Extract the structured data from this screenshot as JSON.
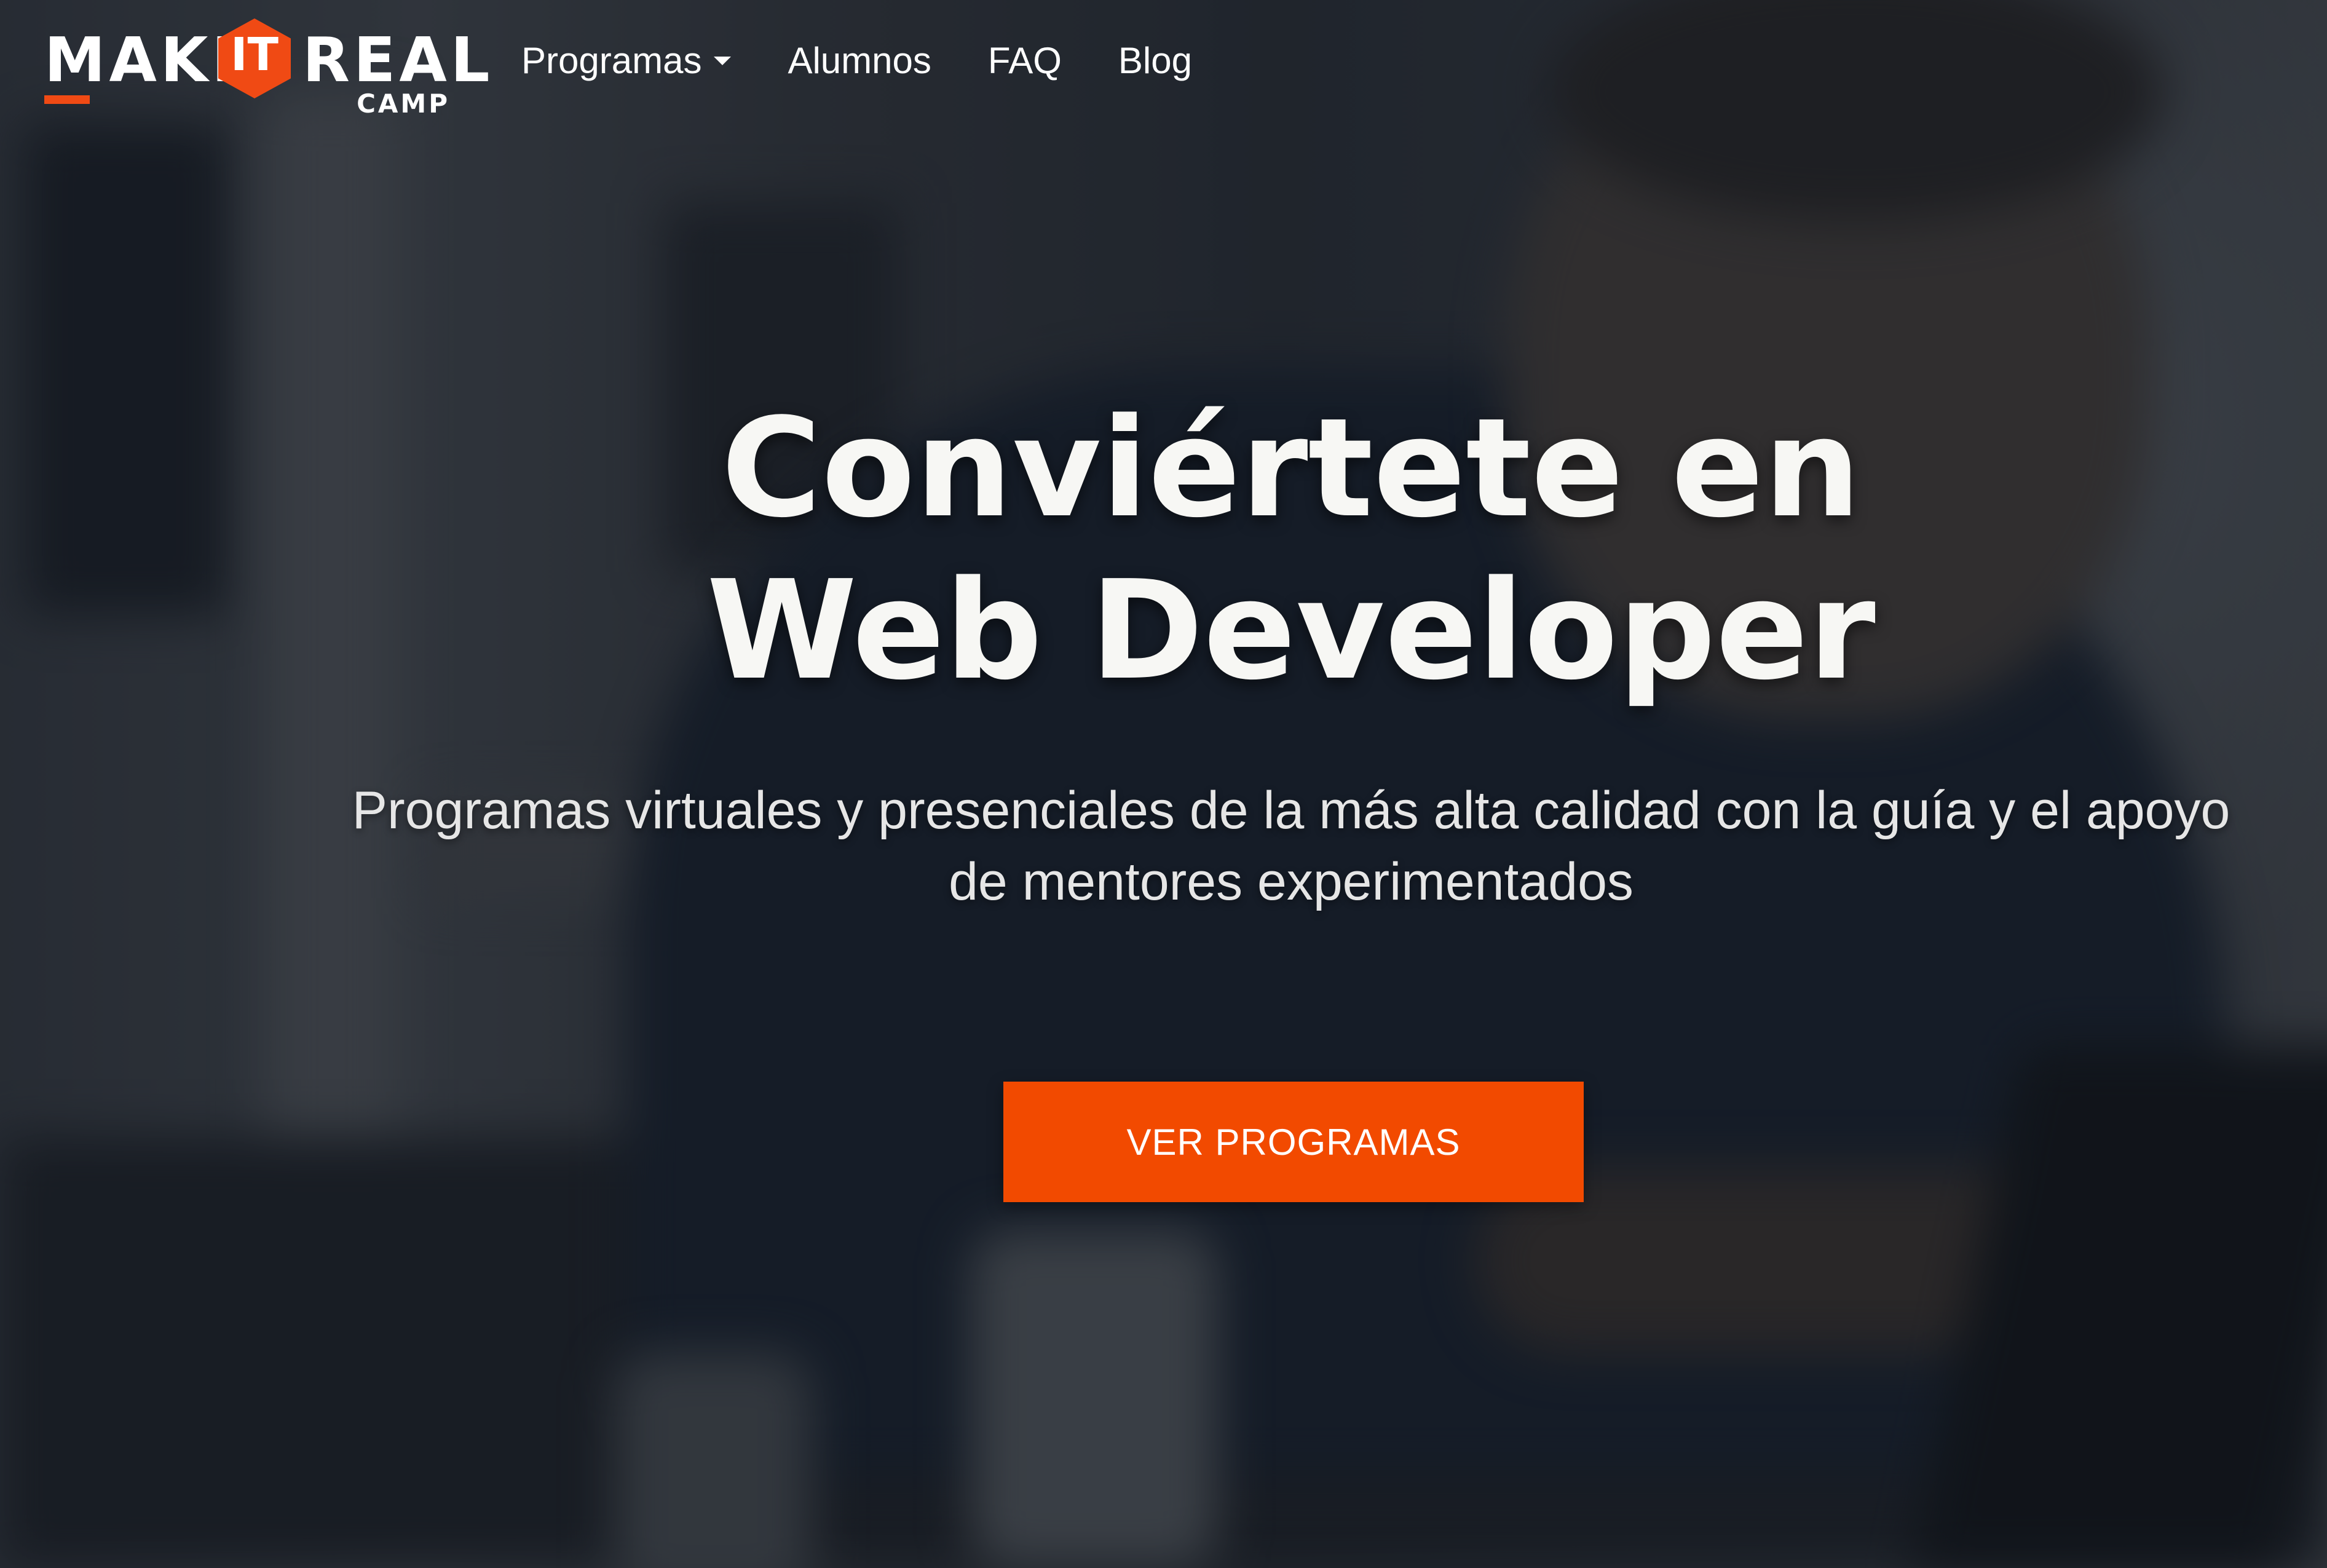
{
  "brand": {
    "logo_word_1": "MAKE",
    "logo_badge": "IT",
    "logo_word_2": "REAL",
    "logo_sub": "CAMP",
    "accent_color": "#f04a14"
  },
  "nav": {
    "items": [
      {
        "label": "Programas",
        "has_dropdown": true,
        "icon": "chevron-down-icon"
      },
      {
        "label": "Alumnos"
      },
      {
        "label": "FAQ"
      },
      {
        "label": "Blog"
      }
    ]
  },
  "hero": {
    "title_line_1": "Conviértete en",
    "title_line_2": "Web Developer",
    "subtitle_line_1": "Programas virtuales y presenciales de la más alta calidad con la guía y el apoyo",
    "subtitle_line_2": "de mentores experimentados",
    "cta_label": "VER PROGRAMAS",
    "cta_color": "#f24a00"
  }
}
